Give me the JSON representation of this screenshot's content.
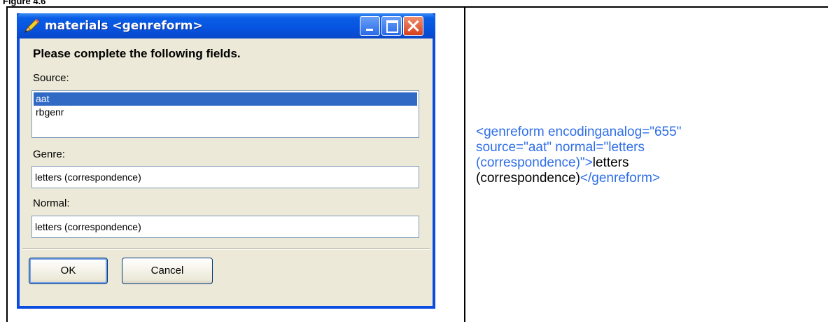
{
  "figure_caption": "Figure 4.6",
  "dialog": {
    "title": "materials <genreform>",
    "instruction": "Please complete the following fields.",
    "source": {
      "label": "Source:",
      "options": [
        "aat",
        "rbgenr"
      ],
      "selected": "aat"
    },
    "genre": {
      "label": "Genre:",
      "value": "letters (correspondence)"
    },
    "normal": {
      "label": "Normal:",
      "value": "letters (correspondence)"
    },
    "ok_label": "OK",
    "cancel_label": "Cancel",
    "icons": {
      "title": "pencil-icon",
      "minimize": "minimize-icon",
      "maximize": "maximize-icon",
      "close": "close-icon"
    }
  },
  "xml_output": {
    "line1": "<genreform encodinganalog=\"655\"",
    "line2": "source=\"aat\" normal=\"letters",
    "line3": "(correspondence)\">",
    "content_part1": "letters",
    "content_part2": "(correspondence)",
    "closing_tag": "</genreform>",
    "markup_color": "#2e6ee8",
    "content_color": "#000000"
  }
}
